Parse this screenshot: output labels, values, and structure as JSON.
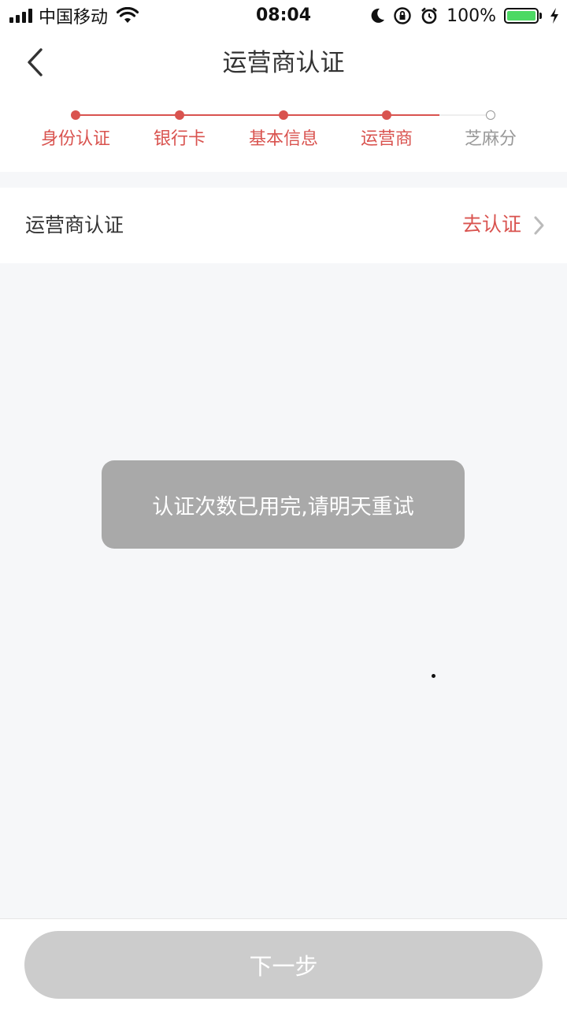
{
  "status_bar": {
    "carrier": "中国移动",
    "time": "08:04",
    "battery": "100%",
    "icons": [
      "signal-icon",
      "wifi-icon",
      "moon-icon",
      "rotation-lock-icon",
      "alarm-icon",
      "battery-icon",
      "charging-icon"
    ]
  },
  "nav": {
    "title": "运营商认证",
    "back_icon": "chevron-left-icon"
  },
  "steps": {
    "items": [
      {
        "label": "身份认证",
        "done": true
      },
      {
        "label": "银行卡",
        "done": true
      },
      {
        "label": "基本信息",
        "done": true
      },
      {
        "label": "运营商",
        "done": true
      },
      {
        "label": "芝麻分",
        "done": false
      }
    ],
    "active_color": "#d9534f",
    "inactive_color": "#999999"
  },
  "operator_row": {
    "label": "运营商认证",
    "action": "去认证"
  },
  "toast": {
    "message": "认证次数已用完,请明天重试"
  },
  "bottom": {
    "next_label": "下一步"
  },
  "colors": {
    "accent": "#d9534f",
    "disabled_button": "#cccccc",
    "toast_bg": "#a9a9a9",
    "battery_green": "#4cd964"
  }
}
